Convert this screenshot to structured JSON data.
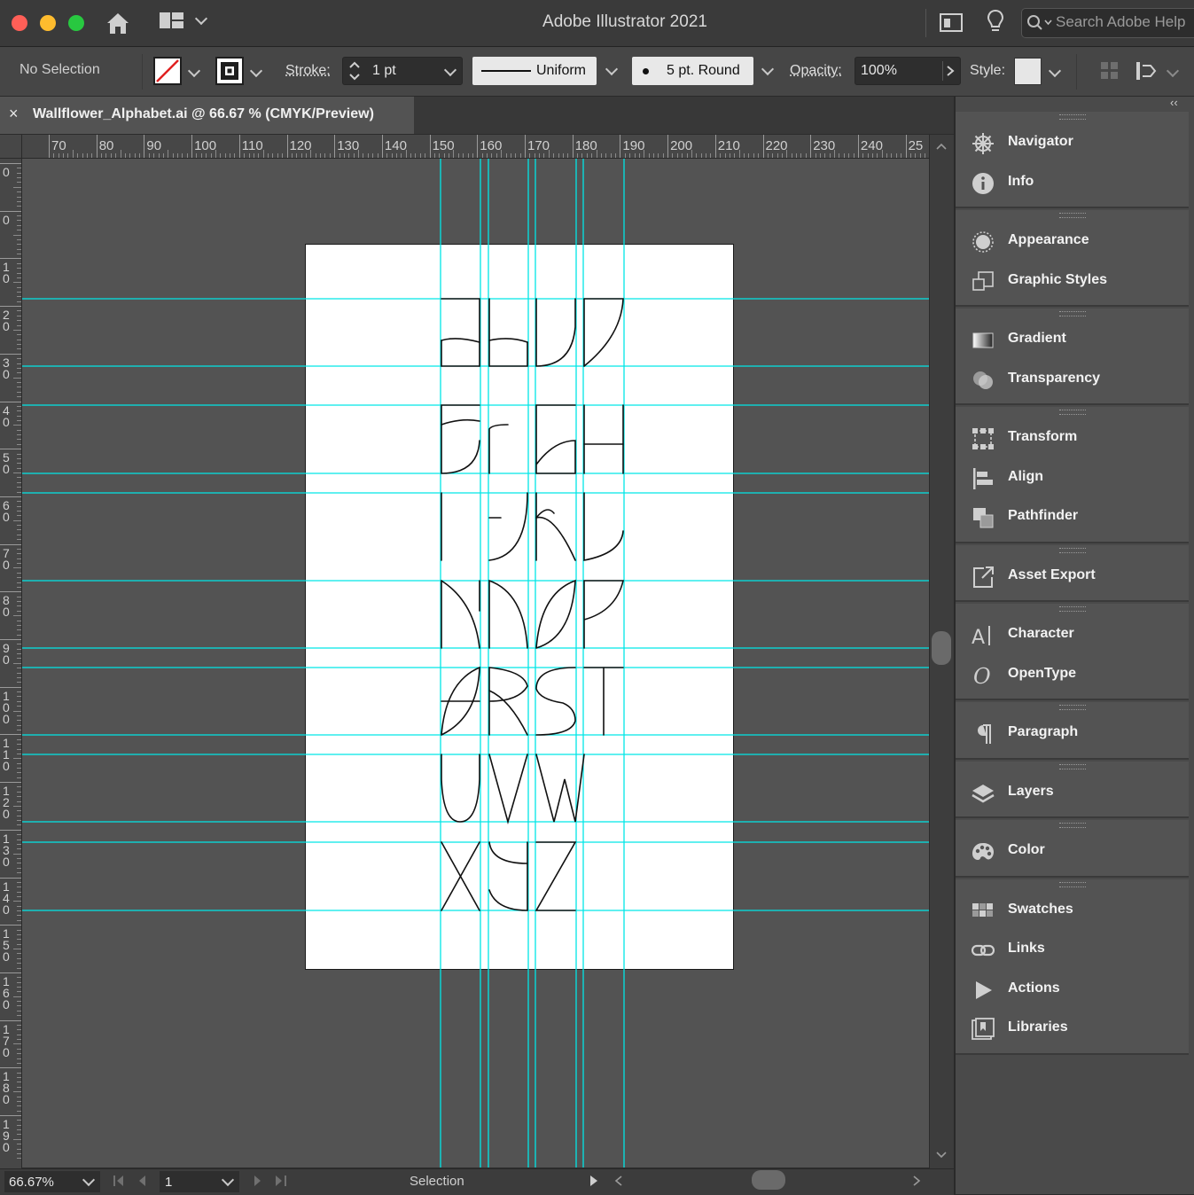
{
  "titlebar": {
    "title": "Adobe Illustrator 2021",
    "search_placeholder": "Search Adobe Help"
  },
  "controlbar": {
    "selection": "No Selection",
    "stroke_label": "Stroke:",
    "stroke_weight": "1 pt",
    "profile": "Uniform",
    "brush": "5 pt. Round",
    "opacity_label": "Opacity:",
    "opacity_value": "100%",
    "style_label": "Style:"
  },
  "document": {
    "tab_title": "Wallflower_Alphabet.ai @ 66.67 % (CMYK/Preview)",
    "close_glyph": "×"
  },
  "rulers": {
    "h_labels": [
      "70",
      "80",
      "90",
      "100",
      "110",
      "120",
      "130",
      "140",
      "150",
      "160",
      "170",
      "180",
      "190",
      "200",
      "210",
      "220",
      "230",
      "240",
      "25"
    ],
    "v_labels": [
      "0",
      "0",
      "10",
      "20",
      "30",
      "40",
      "50",
      "60",
      "70",
      "80",
      "90",
      "100",
      "110",
      "120",
      "130",
      "140",
      "150",
      "160",
      "170",
      "180",
      "190"
    ]
  },
  "statusbar": {
    "zoom": "66.67%",
    "artboard_number": "1",
    "tool": "Selection"
  },
  "panels": {
    "collapse_glyph": "‹‹",
    "groups": [
      [
        {
          "label": "Navigator",
          "icon": "navigator-icon"
        },
        {
          "label": "Info",
          "icon": "info-icon"
        }
      ],
      [
        {
          "label": "Appearance",
          "icon": "appearance-icon"
        },
        {
          "label": "Graphic Styles",
          "icon": "graphic-styles-icon"
        }
      ],
      [
        {
          "label": "Gradient",
          "icon": "gradient-icon"
        },
        {
          "label": "Transparency",
          "icon": "transparency-icon"
        }
      ],
      [
        {
          "label": "Transform",
          "icon": "transform-icon"
        },
        {
          "label": "Align",
          "icon": "align-icon"
        },
        {
          "label": "Pathfinder",
          "icon": "pathfinder-icon"
        }
      ],
      [
        {
          "label": "Asset Export",
          "icon": "asset-export-icon"
        }
      ],
      [
        {
          "label": "Character",
          "icon": "character-icon"
        },
        {
          "label": "OpenType",
          "icon": "opentype-icon"
        }
      ],
      [
        {
          "label": "Paragraph",
          "icon": "paragraph-icon"
        }
      ],
      [
        {
          "label": "Layers",
          "icon": "layers-icon"
        }
      ],
      [
        {
          "label": "Color",
          "icon": "color-icon"
        }
      ],
      [
        {
          "label": "Swatches",
          "icon": "swatches-icon"
        },
        {
          "label": "Links",
          "icon": "links-icon"
        },
        {
          "label": "Actions",
          "icon": "actions-icon"
        },
        {
          "label": "Libraries",
          "icon": "libraries-icon"
        }
      ]
    ]
  },
  "colors": {
    "guide": "#00e6e6",
    "accent_red": "#ff5f57",
    "accent_yellow": "#febc2e",
    "accent_green": "#28c840"
  }
}
